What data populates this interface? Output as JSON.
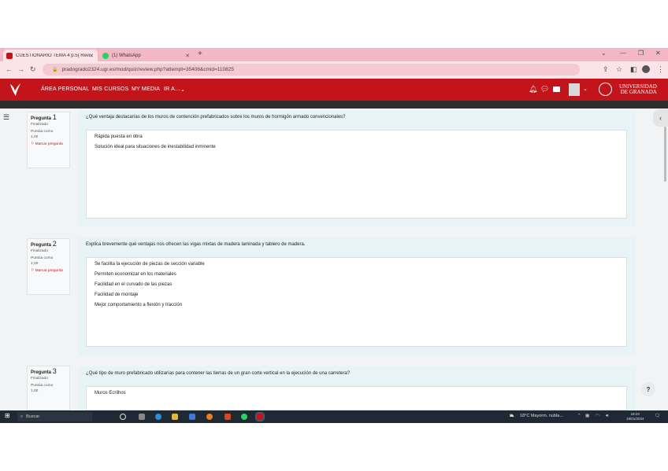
{
  "browser": {
    "tabs": [
      {
        "label": "CUESTIONARIO TEMA 4 p.5( Revi...",
        "favicon_color": "#c4141b",
        "active": true
      },
      {
        "label": "(1) WhatsApp",
        "favicon_color": "#25d366",
        "active": false
      }
    ],
    "url": "pradogrado2324.ugr.es/mod/quiz/review.php?attempt=35406&cmid=110825"
  },
  "navbar": {
    "items": [
      "ÁREA PERSONAL",
      "MIS CURSOS",
      "MY MEDIA",
      "IR A..."
    ],
    "university_line1": "UNIVERSIDAD",
    "university_line2": "DE GRANADA",
    "brand_color": "#c4141b"
  },
  "questions": [
    {
      "label": "Pregunta",
      "number": "1",
      "status": "Finalizado",
      "score_label": "Puntúa como",
      "score": "1,00",
      "flag_label": "Marcar pregunta",
      "text": "¿Qué ventaja destacarías de los muros de contención prefabricados sobre los muros de hormigón armado convencionales?",
      "answer_lines": [
        "Rápida puesta en obra",
        "Solución ideal para situaciones de inestabilidad inminente"
      ]
    },
    {
      "label": "Pregunta",
      "number": "2",
      "status": "Finalizado",
      "score_label": "Puntúa como",
      "score": "1,00",
      "flag_label": "Marcar pregunta",
      "text": "Explica brevemente qué ventajas nos ofrecen las vigas mixtas de madera laminada y tablero de madera.",
      "answer_lines": [
        "Se facilita la ejecución de piezas de sección variable",
        "Permiten economizar en los materiales",
        "Facilidad en el curvado de las piezas",
        "Facilidad de montaje",
        "Mejor comportamiento a flexión y tracción"
      ]
    },
    {
      "label": "Pregunta",
      "number": "3",
      "status": "Finalizado",
      "score_label": "Puntúa como",
      "score": "1,00",
      "text": "¿Qué tipo de muro prefabricado utilizarías para contener las tierras de un gran corte vertical en la ejecución de una carretera?",
      "answer_lines": [
        "Muros Ecrilhos"
      ]
    }
  ],
  "help_label": "?",
  "taskbar": {
    "search_placeholder": "Buscar",
    "weather": "18°C Mayorm. nubla...",
    "time": "18:43",
    "date": "19/01/2024"
  }
}
